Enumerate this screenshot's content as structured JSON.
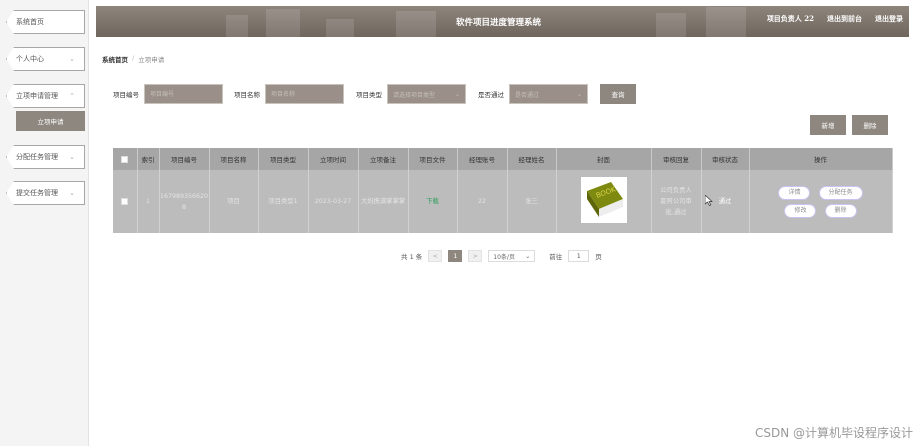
{
  "sidebar": {
    "items": [
      {
        "label": "系统首页"
      },
      {
        "label": "个人中心"
      },
      {
        "label": "立项申请管理"
      },
      {
        "label": "分配任务管理"
      },
      {
        "label": "提交任务管理"
      }
    ],
    "sub_item": "立项申请"
  },
  "header": {
    "title": "软件项目进度管理系统",
    "user": "项目负责人 22",
    "exit_to_backend": "退出到前台",
    "logout": "退出登录"
  },
  "breadcrumb": {
    "home": "系统首页",
    "current": "立项申请"
  },
  "search": {
    "project_no_label": "项目编号",
    "project_no_placeholder": "项目编号",
    "project_name_label": "项目名称",
    "project_name_placeholder": "项目名称",
    "project_type_label": "项目类型",
    "project_type_placeholder": "请选择项目类型",
    "approved_label": "是否通过",
    "approved_placeholder": "是否通过",
    "query_button": "查询"
  },
  "actions": {
    "add": "新增",
    "delete": "删除"
  },
  "table": {
    "headers": [
      "索引",
      "项目编号",
      "项目名称",
      "项目类型",
      "立项时间",
      "立项备注",
      "项目文件",
      "经理账号",
      "经理姓名",
      "封面",
      "审核回复",
      "审核状态",
      "操作"
    ],
    "rows": [
      {
        "index": "1",
        "project_no": "1679893566208",
        "project_name": "项目",
        "project_type": "项目类型1",
        "date": "2023-03-27",
        "remark": "大妈携满掌掌掌",
        "file": "下载",
        "manager_account": "22",
        "manager_name": "张三",
        "review_reply": "公司负责人夏阿公司审批,通过",
        "review_status": "通过",
        "ops": {
          "detail": "详情",
          "assign": "分配任务",
          "edit": "修改",
          "delete": "删除"
        }
      }
    ]
  },
  "pagination": {
    "total": "共 1 条",
    "prev": "<",
    "current_page": "1",
    "next": ">",
    "page_size": "10条/页",
    "goto_label": "前往",
    "goto_value": "1",
    "page_suffix": "页"
  },
  "colors": {
    "accent": "#8e8780",
    "header_bg": "#7a7169",
    "table_header": "#a6a6a6",
    "row_bg": "#bcbcbc"
  },
  "watermark": "CSDN @计算机毕设程序设计"
}
